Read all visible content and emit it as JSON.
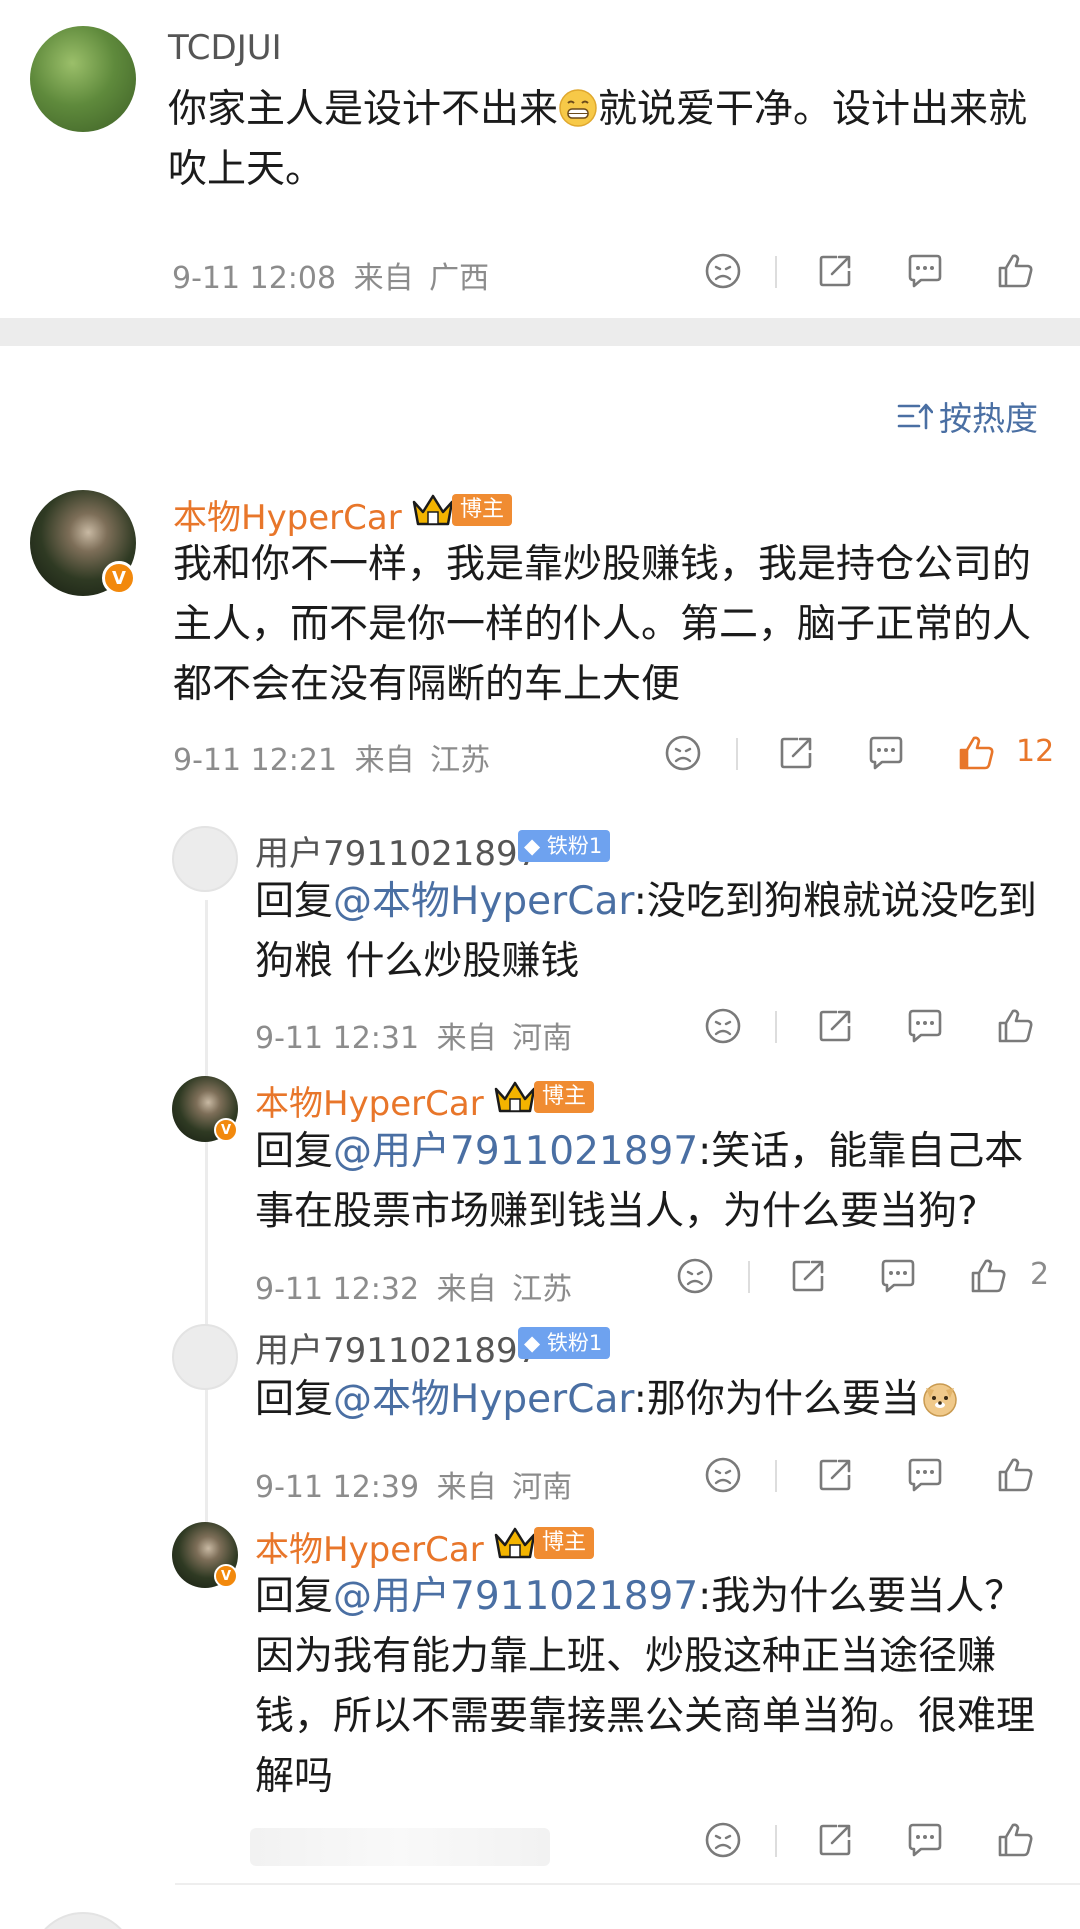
{
  "comments": [
    {
      "user": "TCDJUI",
      "text_a": "你家主人是设计不出来",
      "text_b": "就说爱干净。设计出来就吹上天。",
      "time": "9-11 12:08",
      "from_label": "来自",
      "location": "广西",
      "likes": ""
    },
    {
      "user": "本物HyperCar",
      "badge": "博主",
      "text": "我和你不一样，我是靠炒股赚钱，我是持仓公司的主人，而不是你一样的仆人。第二，脑子正常的人都不会在没有隔断的车上大便",
      "time": "9-11 12:21",
      "from_label": "来自",
      "location": "江苏",
      "likes": "12"
    }
  ],
  "sort_label": "按热度",
  "replies": [
    {
      "user": "用户7911021897",
      "badge": "铁粉1",
      "reply_prefix": "回复",
      "mention": "@本物HyperCar",
      "text": ":没吃到狗粮就说没吃到狗粮 什么炒股赚钱",
      "time": "9-11 12:31",
      "from_label": "来自",
      "location": "河南",
      "likes": ""
    },
    {
      "user": "本物HyperCar",
      "badge": "博主",
      "reply_prefix": "回复",
      "mention": "@用户7911021897",
      "text": ":笑话，能靠自己本事在股票市场赚到钱当人，为什么要当狗?",
      "time": "9-11 12:32",
      "from_label": "来自",
      "location": "江苏",
      "likes": "2"
    },
    {
      "user": "用户7911021897",
      "badge": "铁粉1",
      "reply_prefix": "回复",
      "mention": "@本物HyperCar",
      "text": ":那你为什么要当",
      "time": "9-11 12:39",
      "from_label": "来自",
      "location": "河南",
      "likes": ""
    },
    {
      "user": "本物HyperCar",
      "badge": "博主",
      "reply_prefix": "回复",
      "mention": "@用户7911021897",
      "text": ":我为什么要当人？因为我有能力靠上班、炒股这种正当途径赚钱，所以不需要靠接黑公关商单当狗。很难理解吗",
      "time": "",
      "from_label": "",
      "location": "",
      "likes": ""
    }
  ],
  "colors": {
    "accent_orange": "#e8762a",
    "mention_blue": "#4a6fa3",
    "meta_gray": "#8c8c8c",
    "divider": "#ececec"
  },
  "icons": [
    "dislike-icon",
    "share-icon",
    "comment-icon",
    "like-icon",
    "sort-icon",
    "crown-icon",
    "diamond-icon",
    "verified-badge-icon"
  ]
}
